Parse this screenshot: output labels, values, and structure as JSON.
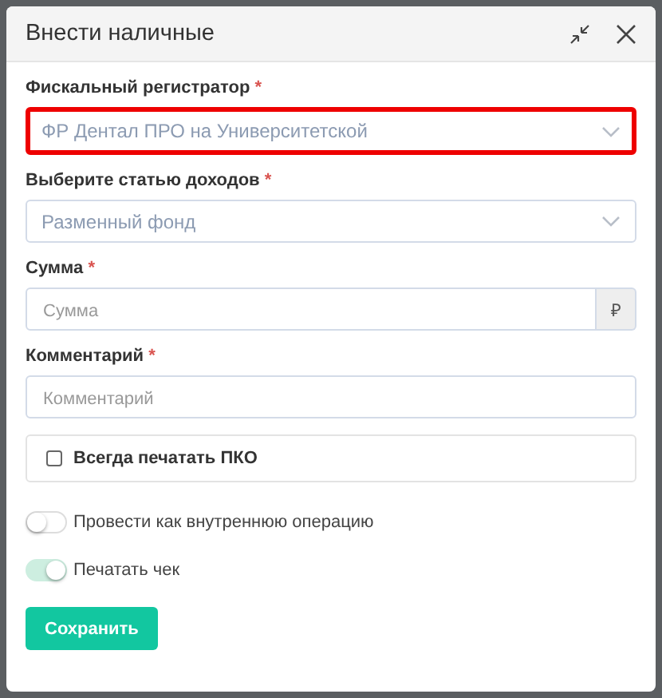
{
  "dialog": {
    "title": "Внести наличные"
  },
  "fields": [
    {
      "kind": "select",
      "label": "Фискальный регистратор",
      "mark": "*",
      "value": "ФР Дентал ПРО на Университетской",
      "highlighted": true
    },
    {
      "kind": "select",
      "label": "Выберите статью доходов",
      "mark": "*",
      "value": "Разменный фонд",
      "highlighted": false
    },
    {
      "kind": "addon",
      "label": "Сумма",
      "mark": "*",
      "placeholder": "Сумма",
      "addon": "₽",
      "highlighted": false
    },
    {
      "kind": "input",
      "label": "Комментарий",
      "mark": "*",
      "placeholder": "Комментарий",
      "highlighted": false
    }
  ],
  "checkbox": {
    "label": "Всегда печатать ПКО",
    "checked": false
  },
  "toggles": [
    {
      "label": "Провести как внутреннюю операцию",
      "on": false
    },
    {
      "label": "Печатать чек",
      "on": true
    }
  ],
  "save_button": "Сохранить"
}
